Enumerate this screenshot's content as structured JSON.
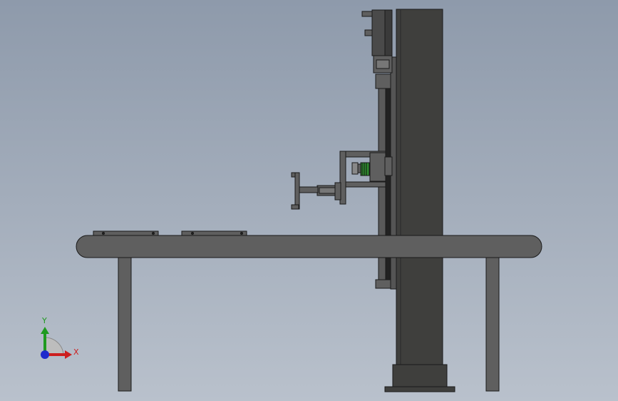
{
  "viewport": {
    "colors": {
      "background_top": "#8e9aab",
      "background_bottom": "#b9c1cc",
      "part_fill": "#5f5f5f",
      "part_fill_dark": "#3f3f3d",
      "edge": "#1a1a1a",
      "gear_accent": "#2e8b2e"
    }
  },
  "triad": {
    "x_label": "X",
    "y_label": "Y",
    "x_color": "#cc1f1f",
    "y_color": "#1f9a1f",
    "z_color": "#1f2acc"
  }
}
